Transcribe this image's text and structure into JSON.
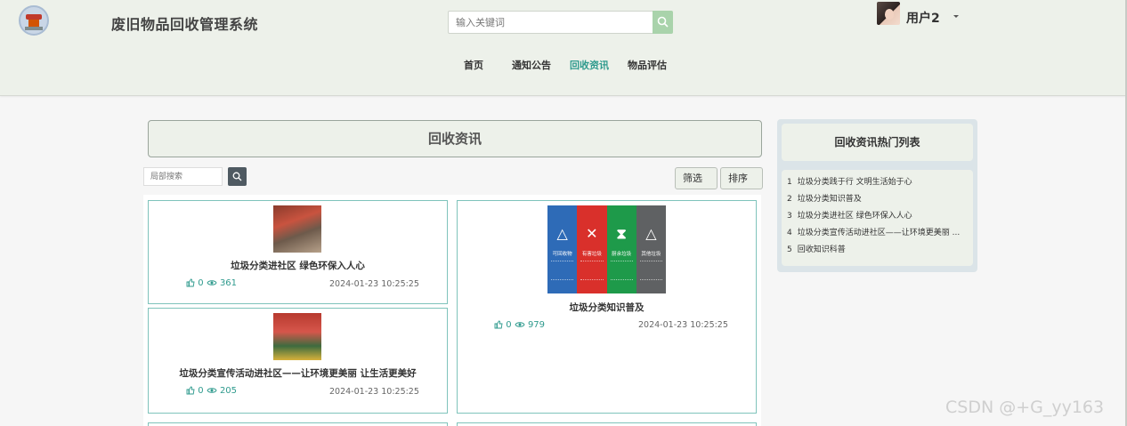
{
  "header": {
    "site_title": "废旧物品回收管理系统",
    "search_placeholder": "输入关键词",
    "username": "用户2"
  },
  "nav": [
    {
      "label": "首页",
      "active": false
    },
    {
      "label": "通知公告",
      "active": false
    },
    {
      "label": "回收资讯",
      "active": true
    },
    {
      "label": "物品评估",
      "active": false
    }
  ],
  "main": {
    "section_title": "回收资讯",
    "local_search_placeholder": "局部搜索",
    "filter_label": "筛选",
    "sort_label": "排序",
    "cards": [
      {
        "title": "垃圾分类进社区 绿色环保入人心",
        "likes": "0",
        "views": "361",
        "date": "2024-01-23 10:25:25"
      },
      {
        "title": "垃圾分类知识普及",
        "likes": "0",
        "views": "979",
        "date": "2024-01-23 10:25:25",
        "bins": [
          {
            "label": "可回收物",
            "color": "#2e6bb7"
          },
          {
            "label": "有害垃圾",
            "color": "#d9302b"
          },
          {
            "label": "厨余垃圾",
            "color": "#1e9a4a"
          },
          {
            "label": "其他垃圾",
            "color": "#5f6163"
          }
        ]
      },
      {
        "title": "垃圾分类宣传活动进社区——让环境更美丽 让生活更美好",
        "likes": "0",
        "views": "205",
        "date": "2024-01-23 10:25:25"
      }
    ]
  },
  "sidebar": {
    "title": "回收资讯热门列表",
    "items": [
      {
        "num": "1",
        "text": "垃圾分类践于行 文明生活始于心"
      },
      {
        "num": "2",
        "text": "垃圾分类知识普及"
      },
      {
        "num": "3",
        "text": "垃圾分类进社区 绿色环保入人心"
      },
      {
        "num": "4",
        "text": "垃圾分类宣传活动进社区——让环境更美丽 ..."
      },
      {
        "num": "5",
        "text": "回收知识科普"
      }
    ]
  },
  "watermark": "CSDN @+G_yy163",
  "colors": {
    "accent": "#2e9a8d",
    "header_bg": "#edf1ea",
    "search_btn": "#a9d3ab"
  },
  "icons": [
    "logo-emblem",
    "search-icon",
    "like-icon",
    "eye-icon",
    "caret-down-icon"
  ]
}
